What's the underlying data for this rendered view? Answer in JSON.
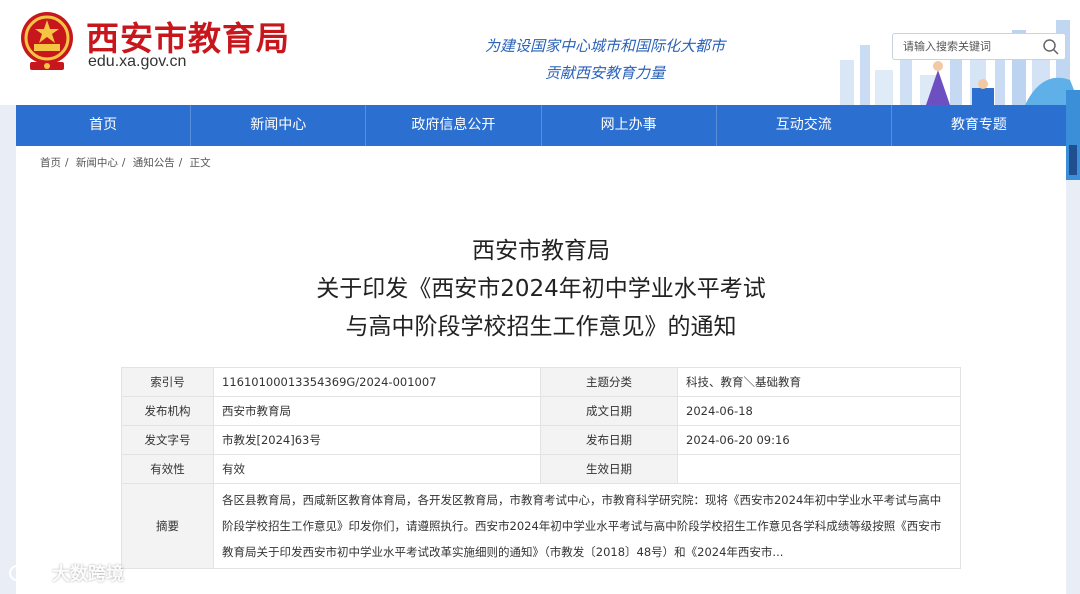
{
  "header": {
    "site_title": "西安市教育局",
    "site_domain": "edu.xa.gov.cn",
    "slogan_line1": "为建设国家中心城市和国际化大都市",
    "slogan_line2": "贡献西安教育力量",
    "search_placeholder": "请输入搜索关键词",
    "accent_color": "#c8161d",
    "slogan_color": "#2b62b8"
  },
  "nav": {
    "color": "#2b6fd1",
    "items": [
      "首页",
      "新闻中心",
      "政府信息公开",
      "网上办事",
      "互动交流",
      "教育专题"
    ]
  },
  "breadcrumb": [
    "首页",
    "新闻中心",
    "通知公告",
    "正文"
  ],
  "document": {
    "title_line1": "西安市教育局",
    "title_line2": "关于印发《西安市2024年初中学业水平考试",
    "title_line3": "与高中阶段学校招生工作意见》的通知"
  },
  "meta": {
    "index_label": "索引号",
    "index_value": "11610100013354369G/2024-001007",
    "topic_label": "主题分类",
    "topic_value": "科技、教育＼基础教育",
    "publisher_label": "发布机构",
    "publisher_value": "西安市教育局",
    "created_label": "成文日期",
    "created_value": "2024-06-18",
    "docno_label": "发文字号",
    "docno_value": "市教发[2024]63号",
    "published_label": "发布日期",
    "published_value": "2024-06-20 09:16",
    "validity_label": "有效性",
    "validity_value": "有效",
    "effective_label": "生效日期",
    "effective_value": "",
    "summary_label": "摘要",
    "summary_value": "各区县教育局，西咸新区教育体育局，各开发区教育局，市教育考试中心，市教育科学研究院：现将《西安市2024年初中学业水平考试与高中阶段学校招生工作意见》印发你们，请遵照执行。西安市2024年初中学业水平考试与高中阶段学校招生工作意见各学科成绩等级按照《西安市教育局关于印发西安市初中学业水平考试改革实施细则的通知》（市教发〔2018〕48号）和《2024年西安市..."
  },
  "watermark": "大数跨境"
}
